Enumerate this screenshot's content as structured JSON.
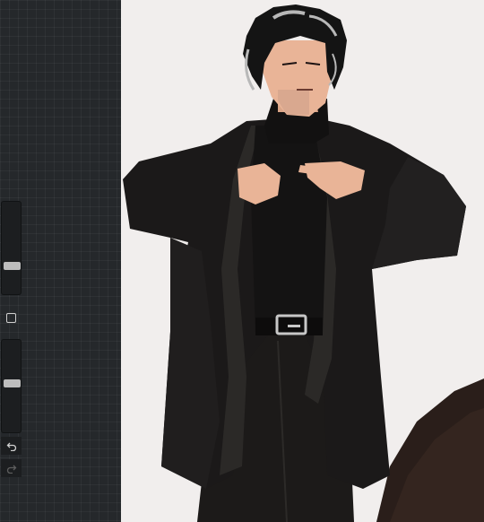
{
  "app": "drawing app",
  "sidebar": {
    "brush_size_slider": {
      "value": 0.62
    },
    "opacity_slider": {
      "value": 0.55
    },
    "modify_button_icon": "square-icon",
    "undo_icon": "undo-arrow-icon",
    "redo_icon": "redo-arrow-icon"
  },
  "canvas": {
    "artwork": "illustration",
    "colors": {
      "background": "#f1eeed",
      "coat": "#1b1919",
      "coat_lining": "#2b2927",
      "skin": "#e9b497",
      "hair": "#141414",
      "hair_highlight": "#b8b8b8"
    }
  }
}
